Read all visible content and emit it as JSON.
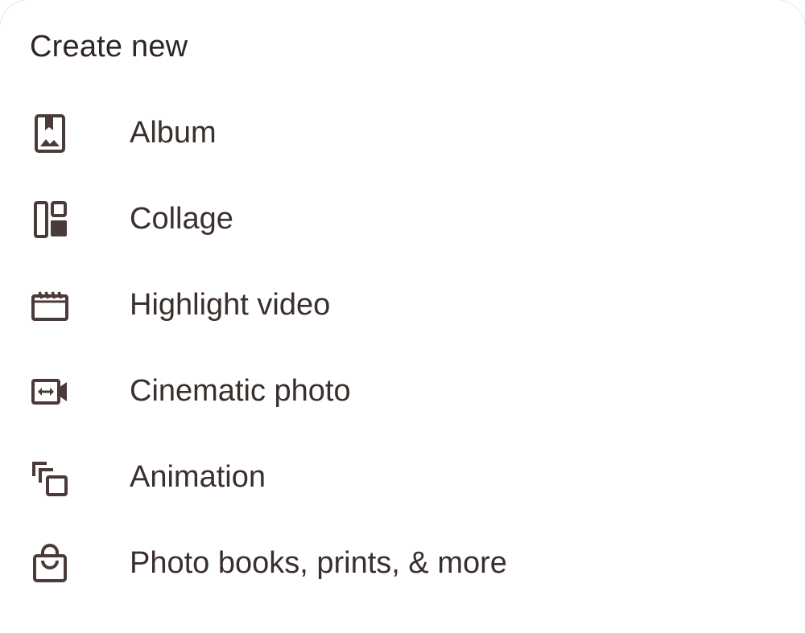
{
  "sheet": {
    "title": "Create new"
  },
  "menu": {
    "items": [
      {
        "label": "Album",
        "icon": "album-icon"
      },
      {
        "label": "Collage",
        "icon": "collage-icon"
      },
      {
        "label": "Highlight video",
        "icon": "highlight-video-icon"
      },
      {
        "label": "Cinematic photo",
        "icon": "cinematic-photo-icon"
      },
      {
        "label": "Animation",
        "icon": "animation-icon"
      },
      {
        "label": "Photo books, prints, & more",
        "icon": "shopping-bag-icon"
      }
    ]
  },
  "colors": {
    "text": "#3a2f2d",
    "icon": "#4a3b38",
    "background": "#ffffff"
  }
}
